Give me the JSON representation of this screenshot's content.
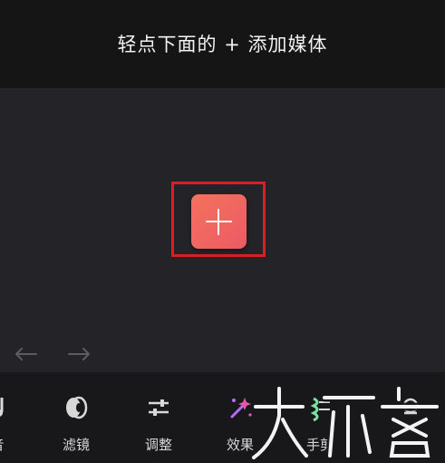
{
  "header": {
    "title": "轻点下面的 + 添加媒体"
  },
  "canvas": {
    "add_button_icon": "plus-icon",
    "undo_icon": "undo-arrow-icon",
    "redo_icon": "redo-arrow-icon",
    "highlight_color": "#d81f26",
    "button_gradient": [
      "#f4715d",
      "#ec5b64"
    ]
  },
  "toolbar": {
    "items": [
      {
        "label": "音",
        "icon": "music-note-icon"
      },
      {
        "label": "滤镜",
        "icon": "filter-lens-icon"
      },
      {
        "label": "调整",
        "icon": "adjust-sliders-icon"
      },
      {
        "label": "效果",
        "icon": "sparkle-effects-icon"
      },
      {
        "label": "手剪",
        "icon": "cut-icon"
      },
      {
        "label": "",
        "icon": "more-icon"
      }
    ]
  },
  "watermark": {
    "text": "大玩客"
  },
  "colors": {
    "header_bg": "#151515",
    "canvas_bg": "#232328",
    "toolbar_bg": "#18181b",
    "text": "#f2f2f2"
  }
}
